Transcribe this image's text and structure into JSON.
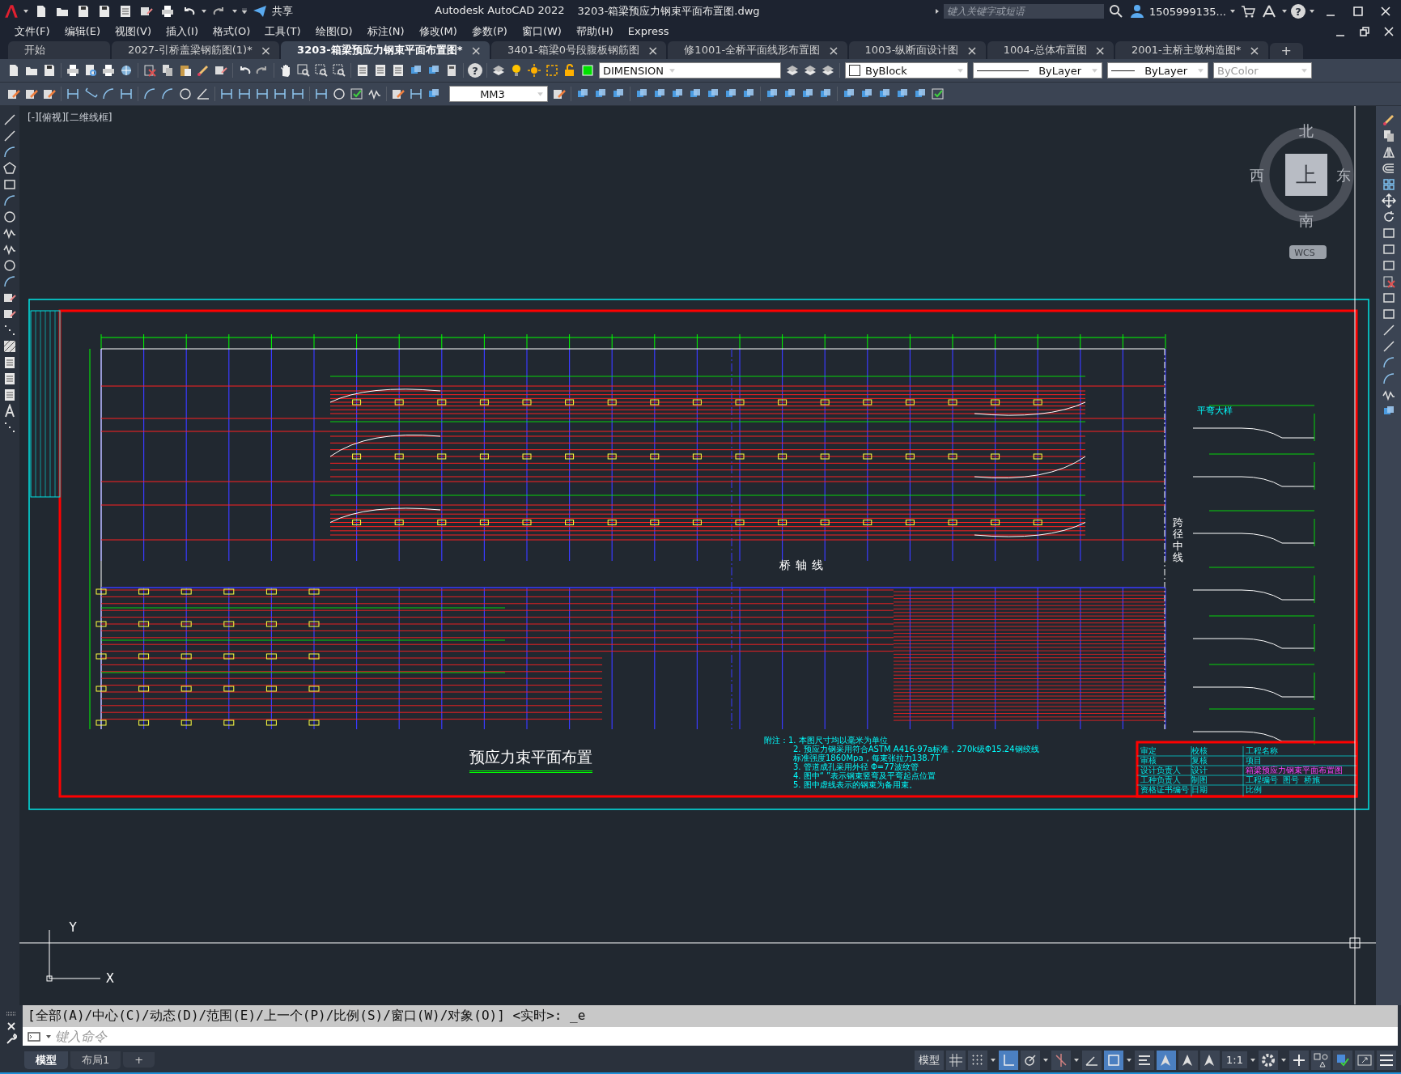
{
  "title_bar": {
    "share": "共享",
    "app_title": "Autodesk AutoCAD 2022",
    "file_name": "3203-箱梁预应力钢束平面布置图.dwg",
    "search": {
      "placeholder": "键入关键字或短语"
    },
    "user": "1505999135...",
    "help_glyph": "?"
  },
  "menu": [
    "文件(F)",
    "编辑(E)",
    "视图(V)",
    "插入(I)",
    "格式(O)",
    "工具(T)",
    "绘图(D)",
    "标注(N)",
    "修改(M)",
    "参数(P)",
    "窗口(W)",
    "帮助(H)",
    "Express"
  ],
  "tabs": [
    {
      "label": "开始",
      "selected": false
    },
    {
      "label": "2027-引桥盖梁钢筋图(1)*",
      "selected": false,
      "close_glyph": "×"
    },
    {
      "label": "3203-箱梁预应力钢束平面布置图*",
      "selected": true,
      "close_glyph": "×"
    },
    {
      "label": "3401-箱梁0号段腹板钢筋图",
      "selected": false,
      "close_glyph": "×"
    },
    {
      "label": "修1001-全桥平面线形布置图",
      "selected": false,
      "close_glyph": "×"
    },
    {
      "label": "1003-纵断面设计图",
      "selected": false,
      "close_glyph": "×"
    },
    {
      "label": "1004-总体布置图",
      "selected": false,
      "close_glyph": "×"
    },
    {
      "label": "2001-主桥主墩构造图*",
      "selected": false,
      "close_glyph": "×"
    }
  ],
  "add_tab": "+",
  "toolbar": {
    "help_glyph": "?",
    "layer": "DIMENSION",
    "color_setting": "ByBlock",
    "linetype": "ByLayer",
    "lineweight": "ByLayer",
    "plot_style": {
      "value": "ByColor",
      "disabled": true
    },
    "dim_style": "MM3"
  },
  "viewport_label": "[-][俯视][二维线框]",
  "viewcube": {
    "north": "北",
    "south": "南",
    "east": "东",
    "west": "西",
    "face": "上",
    "ucs": "WCS"
  },
  "drawing": {
    "title": "预应力束平面布置",
    "axis_label": "桥轴线",
    "span_label": "跨径中线",
    "detail_title": "平弯大样",
    "notes": [
      "附注：1. 本图尺寸均以毫米为单位",
      "2. 预应力钢采用符合ASTM A416-97a标准，270k级Φ15.24钢绞线",
      "标准强度1860Mpa，每束张拉力138.7T",
      "3. 管道成孔采用外径 Φ=77波纹管",
      "4. 图中“ ”表示钢束竖弯及平弯起点位置",
      "5. 图中虚线表示的钢束为备用束。"
    ],
    "title_block": {
      "left_labels": [
        "审定",
        "审核",
        "设计负责人",
        "工种负责人",
        "资格证书编号"
      ],
      "mid_labels": [
        "校核",
        "复核",
        "设计",
        "制图",
        "日期"
      ],
      "project_label": "工程名称",
      "item_label": "项目",
      "sheet_title": "箱梁预应力钢束平面布置图",
      "number_label": "工程编号",
      "scale_label": "比例",
      "drawing_no_label": "图号",
      "drawing_no": "桥施"
    }
  },
  "ucs_icon": {
    "y": "Y",
    "x": "X"
  },
  "command_line": {
    "history": "[全部(A)/中心(C)/动态(D)/范围(E)/上一个(P)/比例(S)/窗口(W)/对象(O)] <实时>: _e",
    "placeholder": "键入命令"
  },
  "layout_tabs": [
    {
      "label": "模型",
      "selected": true
    },
    {
      "label": "布局1",
      "selected": false
    }
  ],
  "add_layout": "+",
  "status_bar": {
    "model": "模型",
    "scale": "1:1",
    "toggles": [
      {
        "kind": "grid",
        "on": false
      },
      {
        "kind": "snap",
        "on": false
      },
      {
        "kind": "ortho",
        "on": true
      },
      {
        "kind": "polar",
        "on": false
      },
      {
        "kind": "tracking",
        "on": false
      },
      {
        "kind": "angle",
        "on": false
      },
      {
        "kind": "osnap",
        "on": true
      },
      {
        "kind": "lineweight",
        "on": false
      },
      {
        "kind": "annovis",
        "on": true
      },
      {
        "kind": "autoscale",
        "on": false
      },
      {
        "kind": "annoscale",
        "on": false
      }
    ]
  }
}
